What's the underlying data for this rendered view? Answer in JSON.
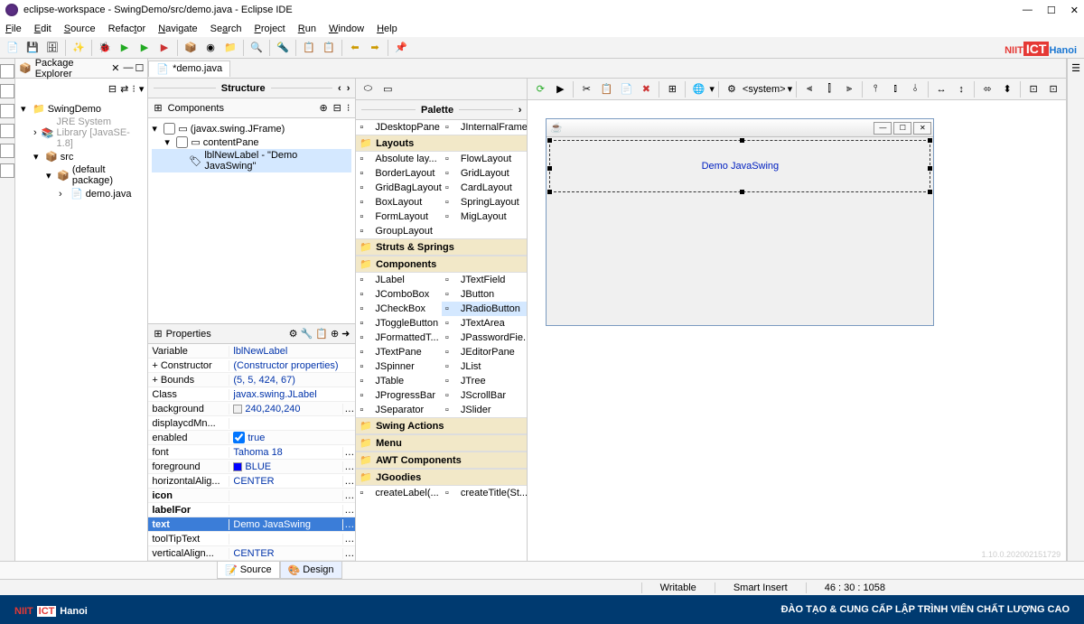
{
  "window": {
    "title": "eclipse-workspace - SwingDemo/src/demo.java - Eclipse IDE"
  },
  "menu": {
    "file": "File",
    "edit": "Edit",
    "source": "Source",
    "refactor": "Refactor",
    "navigate": "Navigate",
    "search": "Search",
    "project": "Project",
    "run": "Run",
    "window": "Window",
    "help": "Help"
  },
  "logo": {
    "niit": "NIIT",
    "ict": "ICT",
    "hanoi": "Hanoi"
  },
  "pkg": {
    "title": "Package Explorer",
    "root": "SwingDemo",
    "jre": "JRE System Library",
    "jre_suffix": " [JavaSE-1.8]",
    "src": "src",
    "defpkg": "(default package)",
    "file": "demo.java"
  },
  "editor": {
    "tab": "*demo.java"
  },
  "structure": {
    "title": "Structure",
    "comp_hdr": "Components",
    "root": "(javax.swing.JFrame)",
    "content": "contentPane",
    "lbl": "lblNewLabel - \"Demo JavaSwing\""
  },
  "props": {
    "title": "Properties",
    "rows": [
      {
        "n": "Variable",
        "v": "lblNewLabel"
      },
      {
        "n": "Constructor",
        "v": "(Constructor properties)",
        "exp": "+"
      },
      {
        "n": "Bounds",
        "v": "(5, 5, 424, 67)",
        "exp": "+"
      },
      {
        "n": "Class",
        "v": "javax.swing.JLabel"
      },
      {
        "n": "background",
        "v": "240,240,240",
        "swatch": "#f0f0f0",
        "dots": true
      },
      {
        "n": "displaycdMn...",
        "v": ""
      },
      {
        "n": "enabled",
        "v": "true",
        "chk": true
      },
      {
        "n": "font",
        "v": "Tahoma 18",
        "dots": true
      },
      {
        "n": "foreground",
        "v": "BLUE",
        "swatch": "#0000ff",
        "dots": true
      },
      {
        "n": "horizontalAlig...",
        "v": "CENTER",
        "dots": true
      },
      {
        "n": "icon",
        "v": "",
        "bold": true,
        "dots": true
      },
      {
        "n": "labelFor",
        "v": "",
        "bold": true,
        "dots": true
      },
      {
        "n": "text",
        "v": "Demo JavaSwing",
        "bold": true,
        "sel": true,
        "dots": true
      },
      {
        "n": "toolTipText",
        "v": "",
        "dots": true
      },
      {
        "n": "verticalAlign...",
        "v": "CENTER",
        "dots": true
      }
    ]
  },
  "palette": {
    "title": "Palette",
    "row0": [
      "JDesktopPane",
      "JInternalFrame"
    ],
    "layouts_hdr": "Layouts",
    "layouts": [
      [
        "Absolute lay...",
        "FlowLayout"
      ],
      [
        "BorderLayout",
        "GridLayout"
      ],
      [
        "GridBagLayout",
        "CardLayout"
      ],
      [
        "BoxLayout",
        "SpringLayout"
      ],
      [
        "FormLayout",
        "MigLayout"
      ],
      [
        "GroupLayout",
        ""
      ]
    ],
    "struts_hdr": "Struts & Springs",
    "comp_hdr": "Components",
    "components": [
      [
        "JLabel",
        "JTextField"
      ],
      [
        "JComboBox",
        "JButton"
      ],
      [
        "JCheckBox",
        "JRadioButton"
      ],
      [
        "JToggleButton",
        "JTextArea"
      ],
      [
        "JFormattedT...",
        "JPasswordFie..."
      ],
      [
        "JTextPane",
        "JEditorPane"
      ],
      [
        "JSpinner",
        "JList"
      ],
      [
        "JTable",
        "JTree"
      ],
      [
        "JProgressBar",
        "JScrollBar"
      ],
      [
        "JSeparator",
        "JSlider"
      ]
    ],
    "comp_sel": "JRadioButton",
    "swing_actions": "Swing Actions",
    "menu_hdr": "Menu",
    "awt_hdr": "AWT Components",
    "jgoodies": "JGoodies",
    "jgoodies_items": [
      "createLabel(...",
      "createTitle(St..."
    ]
  },
  "designer": {
    "system": "<system>",
    "label_text": "Demo JavaSwing",
    "version": "1.10.0.202002151729"
  },
  "bottom_tabs": {
    "source": "Source",
    "design": "Design"
  },
  "status": {
    "writable": "Writable",
    "insert": "Smart Insert",
    "pos": "46 : 30 : 1058"
  },
  "footer": {
    "text": "ĐÀO TẠO & CUNG CẤP LẬP TRÌNH VIÊN CHẤT LƯỢNG CAO"
  }
}
